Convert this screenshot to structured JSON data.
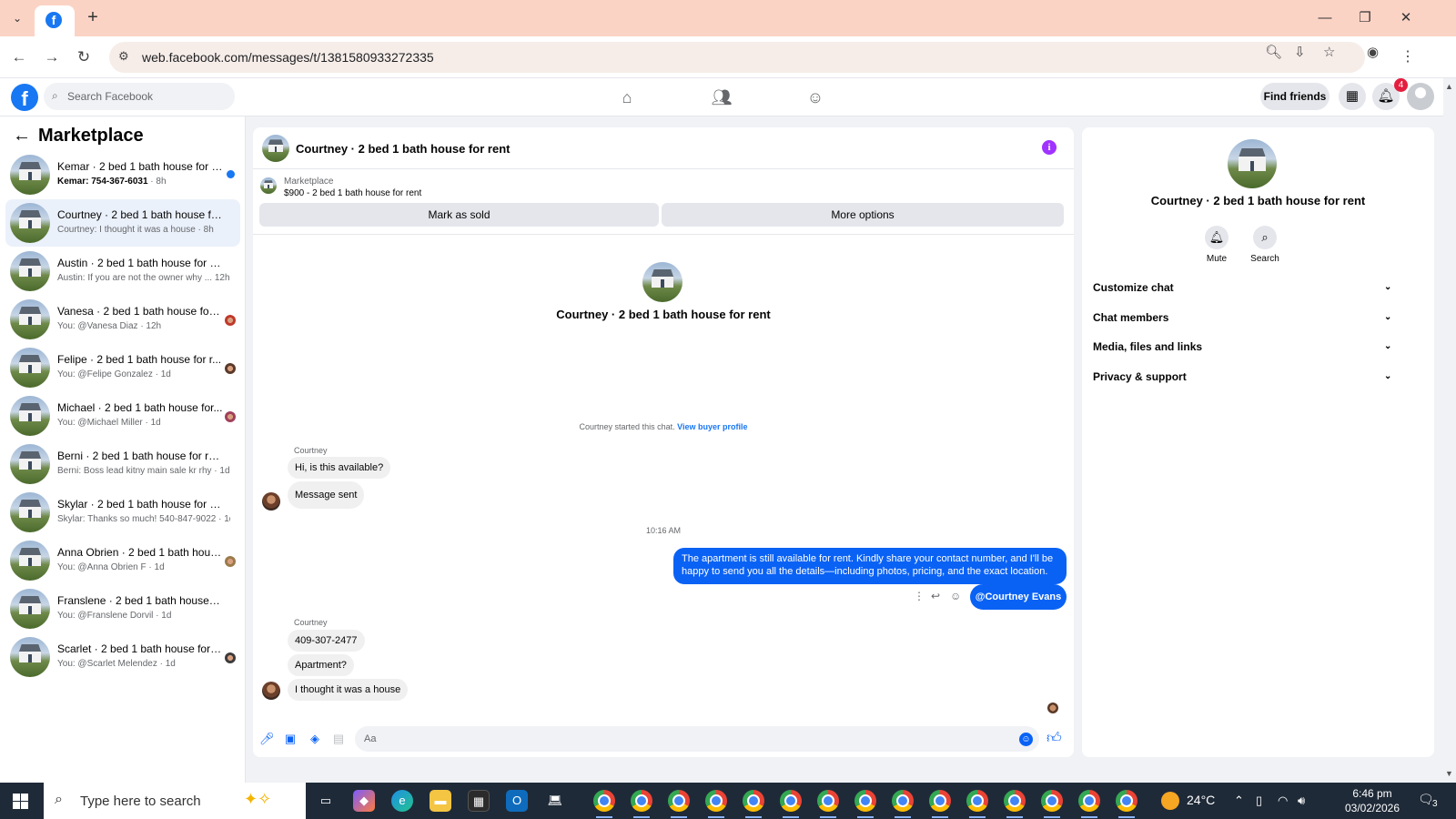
{
  "browser": {
    "url": "web.facebook.com/messages/t/1381580933272335"
  },
  "fb": {
    "search_placeholder": "Search Facebook",
    "find_friends": "Find friends",
    "notification_count": "4"
  },
  "sidebar": {
    "title": "Marketplace",
    "conversations": [
      {
        "name": "Kemar · 2 bed 1 bath house for r...",
        "preview_bold": "Kemar: 754-367-6031",
        "preview": " · 8h",
        "unread": true
      },
      {
        "name": "Courtney · 2 bed 1 bath house for ...",
        "preview": "Courtney: I thought it was a house · 8h",
        "active": true
      },
      {
        "name": "Austin · 2 bed 1 bath house for rent",
        "preview": "Austin: If you are not the owner why ... 12h"
      },
      {
        "name": "Vanesa · 2 bed 1 bath house for ...",
        "preview": "You: @Vanesa Diaz · 12h"
      },
      {
        "name": "Felipe · 2 bed 1 bath house for r...",
        "preview": "You: @Felipe Gonzalez · 1d"
      },
      {
        "name": "Michael · 2 bed 1 bath house for...",
        "preview": "You: @Michael Miller · 1d"
      },
      {
        "name": "Berni · 2 bed 1 bath house for rent",
        "preview": "Berni: Boss lead kitny main sale kr rhy · 1d"
      },
      {
        "name": "Skylar · 2 bed 1 bath house for rent",
        "preview": "Skylar: Thanks so much! 540-847-9022 · 1d"
      },
      {
        "name": "Anna Obrien · 2 bed 1 bath hous...",
        "preview": "You: @Anna Obrien F · 1d"
      },
      {
        "name": "Franslene · 2 bed 1 bath house for ...",
        "preview": "You: @Franslene Dorvil · 1d"
      },
      {
        "name": "Scarlet · 2 bed 1 bath house for r...",
        "preview": "You: @Scarlet Melendez · 1d"
      }
    ]
  },
  "chat": {
    "title": "Courtney · 2 bed 1 bath house for rent",
    "listing_category": "Marketplace",
    "listing_price": "$900 - 2 bed 1 bath house for rent",
    "mark_sold": "Mark as sold",
    "more_options": "More options",
    "started_text": "Courtney started this chat.",
    "view_profile": "View buyer profile",
    "sender": "Courtney",
    "msg1": "Hi, is this available?",
    "msg2": "Message sent",
    "timestamp": "10:16 AM",
    "outgoing": "The apartment is still available for rent. Kindly share your contact number, and I'll be happy to send you all the details—including photos, pricing, and the exact location.",
    "mention": "@Courtney Evans",
    "msg3": "409-307-2477",
    "msg4": "Apartment?",
    "msg5": "I thought it was a house",
    "composer_placeholder": "Aa"
  },
  "details": {
    "name": "Courtney · 2 bed 1 bath house for rent",
    "mute": "Mute",
    "search": "Search",
    "sections": [
      "Customize chat",
      "Chat members",
      "Media, files and links",
      "Privacy & support"
    ]
  },
  "taskbar": {
    "search_placeholder": "Type here to search",
    "temperature": "24°C",
    "time": "6:46 pm",
    "date": "03/02/2026",
    "notif_count": "3"
  }
}
